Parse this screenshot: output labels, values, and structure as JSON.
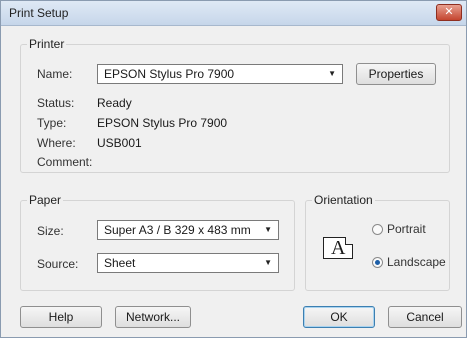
{
  "window": {
    "title": "Print Setup",
    "close_glyph": "✕"
  },
  "printer": {
    "group_label": "Printer",
    "name_label": "Name:",
    "name_value": "EPSON Stylus Pro 7900",
    "properties_button": "Properties",
    "status_label": "Status:",
    "status_value": "Ready",
    "type_label": "Type:",
    "type_value": "EPSON Stylus Pro 7900",
    "where_label": "Where:",
    "where_value": "USB001",
    "comment_label": "Comment:"
  },
  "paper": {
    "group_label": "Paper",
    "size_label": "Size:",
    "size_value": "Super A3 / B 329 x 483 mm",
    "source_label": "Source:",
    "source_value": "Sheet"
  },
  "orientation": {
    "group_label": "Orientation",
    "icon_glyph": "A",
    "portrait_label": "Portrait",
    "landscape_label": "Landscape",
    "selected": "Landscape"
  },
  "buttons": {
    "help": "Help",
    "network": "Network...",
    "ok": "OK",
    "cancel": "Cancel"
  },
  "icons": {
    "dropdown": "dropdown-arrow-icon",
    "close": "close-icon"
  }
}
